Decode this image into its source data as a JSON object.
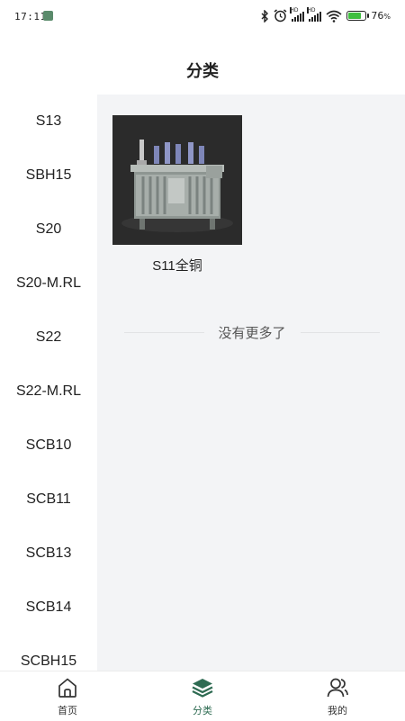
{
  "status_bar": {
    "time": "17:11",
    "battery": "76"
  },
  "header": {
    "title": "分类"
  },
  "sidebar": {
    "items": [
      "S13",
      "SBH15",
      "S20",
      "S20-M.RL",
      "S22",
      "S22-M.RL",
      "SCB10",
      "SCB11",
      "SCB13",
      "SCB14",
      "SCBH15"
    ]
  },
  "main": {
    "products": [
      {
        "name": "S11全铜"
      }
    ],
    "end_text": "没有更多了"
  },
  "tabbar": {
    "tabs": [
      {
        "label": "首页",
        "icon": "home-icon"
      },
      {
        "label": "分类",
        "icon": "layers-icon"
      },
      {
        "label": "我的",
        "icon": "user-icon"
      }
    ],
    "active_color": "#2e6b52"
  }
}
